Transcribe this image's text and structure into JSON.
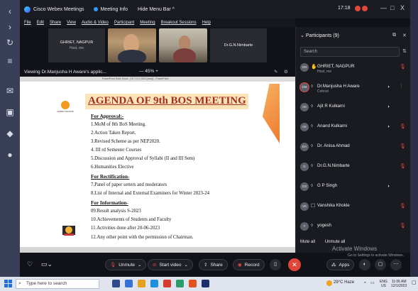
{
  "colors": {
    "accent_red": "#e24a3f",
    "slide_title": "#a0301f",
    "orange": "#ee7a2e"
  },
  "window": {
    "app_title": "Cisco Webex Meetings",
    "meeting_info": "Meeting Info",
    "hide_menu": "Hide Menu Bar ^",
    "time": "17:18",
    "min": "—",
    "max": "□",
    "close": "X"
  },
  "menu": [
    "File",
    "Edit",
    "Share",
    "View",
    "Audio & Video",
    "Participant",
    "Meeting",
    "Breakout Sessions",
    "Help"
  ],
  "tiles": [
    {
      "name": "GHRIET, NAGPUR",
      "sub": "Host, me"
    },
    {
      "name": "Dr.G.N.Nimbarte"
    }
  ],
  "viewbar": {
    "label": "Viewing Dr.Manjusha H Aware's applic...",
    "zoom": "— 45% +"
  },
  "slide": {
    "window_title": "PowerPoint Slide Show - [Of 7.0.0 2023 (new)] - PowerPoint",
    "logo_text": "GHRIET NAGPUR",
    "title": "AGENDA OF 9th BOS MEETING",
    "sections": [
      {
        "heading": "For Approval:-",
        "items": [
          "1.MoM of 8th BoS Meeting.",
          "2.Action Taken Report.",
          "3.Revised Scheme as per NEP2020.",
          "4. III rd Semester Courses",
          "5.Discussion and Approval of Syllabi (II and III Sem)",
          "6.Humanities Elective"
        ]
      },
      {
        "heading": "For Rectification-",
        "items": [
          "7.Panel of paper setters and moderators",
          "8.List of Internal and External Examiners for Winter 2023-24"
        ]
      },
      {
        "heading": "For Information-",
        "items": [
          "09.Result analysis S-2023",
          "10.Achievements of Students and Faculty",
          "11.Activities done after 20-06-2023",
          "12.Any other point with the permission of Chairman."
        ]
      }
    ]
  },
  "participants_panel": {
    "header": "Participants (9)",
    "search_placeholder": "Search",
    "mute_all": "Mute all",
    "unmute_all": "Unmute all",
    "list": [
      {
        "initials": "GN",
        "name": "GHRIET, NAGPUR",
        "role": "Host, me",
        "video": "",
        "mic": "muted"
      },
      {
        "initials": "DM",
        "name": "Dr.Manjusha H Aware",
        "role": "Cohost",
        "video": "cam",
        "mic": "on"
      },
      {
        "initials": "AK",
        "name": "Ajit R Kulkarni",
        "role": "",
        "video": "cam",
        "mic": ""
      },
      {
        "initials": "AK",
        "name": "Anand Kulkarni",
        "role": "",
        "video": "cam",
        "mic": "muted"
      },
      {
        "initials": "DA",
        "name": "Dr. Anisa Ahmad",
        "role": "",
        "video": "",
        "mic": "muted"
      },
      {
        "initials": "D",
        "name": "Dr.G.N.Nimbarte",
        "role": "",
        "video": "",
        "mic": "muted"
      },
      {
        "initials": "GS",
        "name": "G P Singh",
        "role": "",
        "video": "cam",
        "mic": ""
      },
      {
        "initials": "VK",
        "name": "Vanshika Khokle",
        "role": "",
        "video": "",
        "mic": "muted"
      },
      {
        "initials": "Y",
        "name": "yogesh",
        "role": "",
        "video": "",
        "mic": "muted"
      }
    ]
  },
  "controls": {
    "unmute": "Unmute",
    "start_video": "Start video",
    "share": "Share",
    "record": "Record",
    "apps": "Apps",
    "activate": "Activate Windows",
    "activate_sub": "Go to Settings to activate Windows."
  },
  "taskbar": {
    "search_placeholder": "Type here to search",
    "weather": "29°C Haze",
    "lang": "ENG",
    "region": "US",
    "time": "11:06 AM",
    "date": "12/1/2023"
  }
}
